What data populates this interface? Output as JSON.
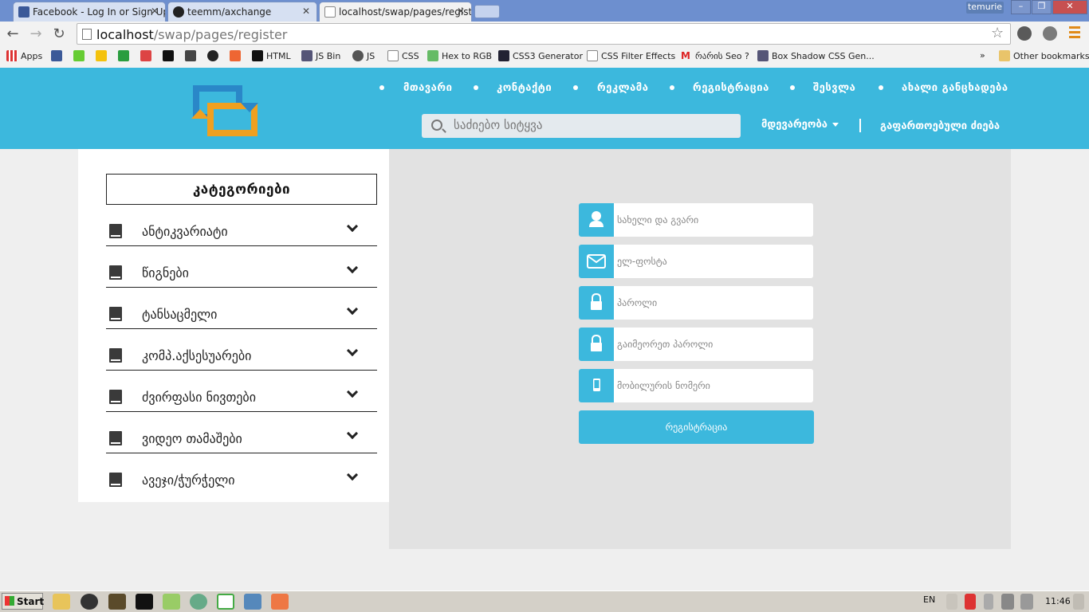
{
  "browser": {
    "tabs": [
      {
        "title": "Facebook - Log In or Sign Up",
        "icon": "facebook-icon",
        "color": "#3b5998"
      },
      {
        "title": "teemm/axchange",
        "icon": "github-icon",
        "color": "#222222"
      },
      {
        "title": "localhost/swap/pages/register",
        "icon": "page-icon",
        "color": "#ffffff"
      }
    ],
    "profile": "temurie",
    "url_host": "localhost",
    "url_path": "/swap/pages/register",
    "bookmarks": [
      {
        "label": "Apps"
      },
      {
        "label": ""
      },
      {
        "label": ""
      },
      {
        "label": ""
      },
      {
        "label": ""
      },
      {
        "label": ""
      },
      {
        "label": ""
      },
      {
        "label": ""
      },
      {
        "label": ""
      },
      {
        "label": ""
      },
      {
        "label": "HTML"
      },
      {
        "label": "JS Bin"
      },
      {
        "label": "JS"
      },
      {
        "label": "CSS"
      },
      {
        "label": "Hex to RGB"
      },
      {
        "label": "CSS3 Generator"
      },
      {
        "label": "CSS Filter Effects"
      },
      {
        "label": "რარის Seo ?"
      },
      {
        "label": "Box Shadow CSS Gen..."
      }
    ],
    "more_bookmarks": "»",
    "other_bookmarks": "Other bookmarks"
  },
  "header": {
    "nav": [
      "მთავარი",
      "კონტაქტი",
      "რეკლამა",
      "რეგისტრაცია",
      "შესვლა",
      "ახალი განცხადება"
    ],
    "search_placeholder": "საძიებო სიტყვა",
    "popular": "მდევარეობა",
    "advanced_search": "გაფართოებული ძიება",
    "accent": "#3cb8dd"
  },
  "sidebar": {
    "title": "კატეგორიები",
    "categories": [
      "ანტიკვარიატი",
      "წიგნები",
      "ტანსაცმელი",
      "კომპ.აქსესუარები",
      "ძვირფასი ნივთები",
      "ვიდეო თამაშები",
      "ავეჯი/ჭურჭელი"
    ]
  },
  "form": {
    "name_placeholder": "სახელი და გვარი",
    "email_placeholder": "ელ-ფოსტა",
    "password_placeholder": "პაროლი",
    "repeat_password_placeholder": "გაიმეორეთ პაროლი",
    "phone_placeholder": "მობილურის ნომერი",
    "submit": "რეგისტრაცია"
  },
  "taskbar": {
    "start": "Start",
    "language": "EN",
    "time": "11:46"
  }
}
